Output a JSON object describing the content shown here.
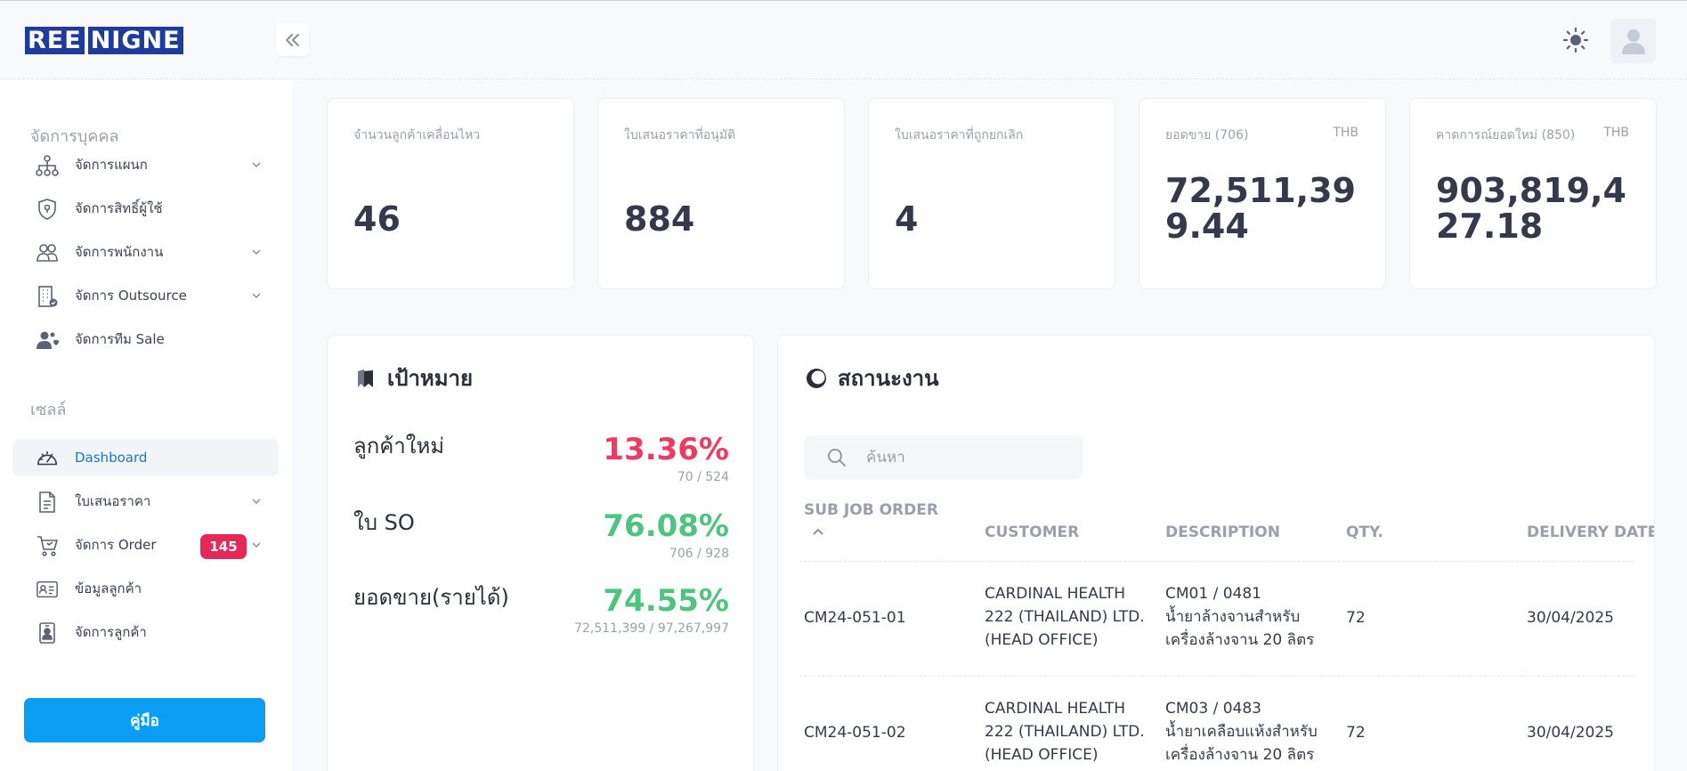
{
  "header": {
    "logo_left": "REE",
    "logo_right": "NIGNE"
  },
  "sidebar": {
    "section_people": "จัดการบุคคล",
    "section_sales": "เซลล์",
    "items": [
      {
        "label": "จัดการแผนก",
        "icon": "org-chart-icon"
      },
      {
        "label": "จัดการสิทธิ์ผู้ใช้",
        "icon": "shield-lock-icon"
      },
      {
        "label": "จัดการพนักงาน",
        "icon": "users-icon"
      },
      {
        "label": "จัดการ Outsource",
        "icon": "building-icon"
      },
      {
        "label": "จัดการทีม Sale",
        "icon": "team-heart-icon"
      },
      {
        "label": "Dashboard",
        "icon": "dashboard-gauge-icon"
      },
      {
        "label": "ใบเสนอราคา",
        "icon": "document-icon"
      },
      {
        "label": "จัดการ Order",
        "icon": "cart-icon",
        "badge": "145"
      },
      {
        "label": "ข้อมูลลูกค้า",
        "icon": "id-card-icon"
      },
      {
        "label": "จัดการลูกค้า",
        "icon": "contact-badge-icon"
      }
    ],
    "manual_button": "คู่มือ"
  },
  "stats": [
    {
      "label": "จำนวนลูกค้าเคลื่อนไหว",
      "unit": "",
      "value": "46"
    },
    {
      "label": "ใบเสนอราคาที่อนุมัติ",
      "unit": "",
      "value": "884"
    },
    {
      "label": "ใบเสนอราคาที่ถูกยกเลิก",
      "unit": "",
      "value": "4"
    },
    {
      "label": "ยอดขาย (706)",
      "unit": "THB",
      "value": "72,511,399.44"
    },
    {
      "label": "คาดการณ์ยอดใหม่ (850)",
      "unit": "THB",
      "value": "903,819,427.18"
    }
  ],
  "goal": {
    "title": "เป้าหมาย",
    "rows": [
      {
        "label": "ลูกค้าใหม่",
        "percent": "13.36%",
        "sub": "70 / 524",
        "progress": 0.1336
      },
      {
        "label": "ใบ SO",
        "percent": "76.08%",
        "sub": "706 / 928",
        "progress": 0.7608
      },
      {
        "label": "ยอดขาย(รายได้)",
        "percent": "74.55%",
        "sub": "72,511,399 / 97,267,997",
        "progress": 0.7455
      }
    ]
  },
  "status": {
    "title": "สถานะงาน",
    "search_placeholder": "ค้นหา",
    "columns": [
      "SUB JOB ORDER",
      "CUSTOMER",
      "DESCRIPTION",
      "QTY.",
      "DELIVERY DATE"
    ],
    "rows": [
      {
        "job": "CM24-051-01",
        "customer": [
          "CARDINAL HEALTH",
          "222 (THAILAND) LTD.",
          "(HEAD OFFICE)"
        ],
        "description": [
          "CM01 / 0481",
          "น้ำยาล้างจานสำหรับ",
          "เครื่องล้างจาน 20 ลิตร"
        ],
        "qty": "72",
        "delivery": "30/04/2025"
      },
      {
        "job": "CM24-051-02",
        "customer": [
          "CARDINAL HEALTH",
          "222 (THAILAND) LTD.",
          "(HEAD OFFICE)"
        ],
        "description": [
          "CM03 / 0483",
          "น้ำยาเคลือบแห้งสำหรับ",
          "เครื่องล้างจาน 20 ลิตร"
        ],
        "qty": "72",
        "delivery": "30/04/2025"
      }
    ]
  }
}
